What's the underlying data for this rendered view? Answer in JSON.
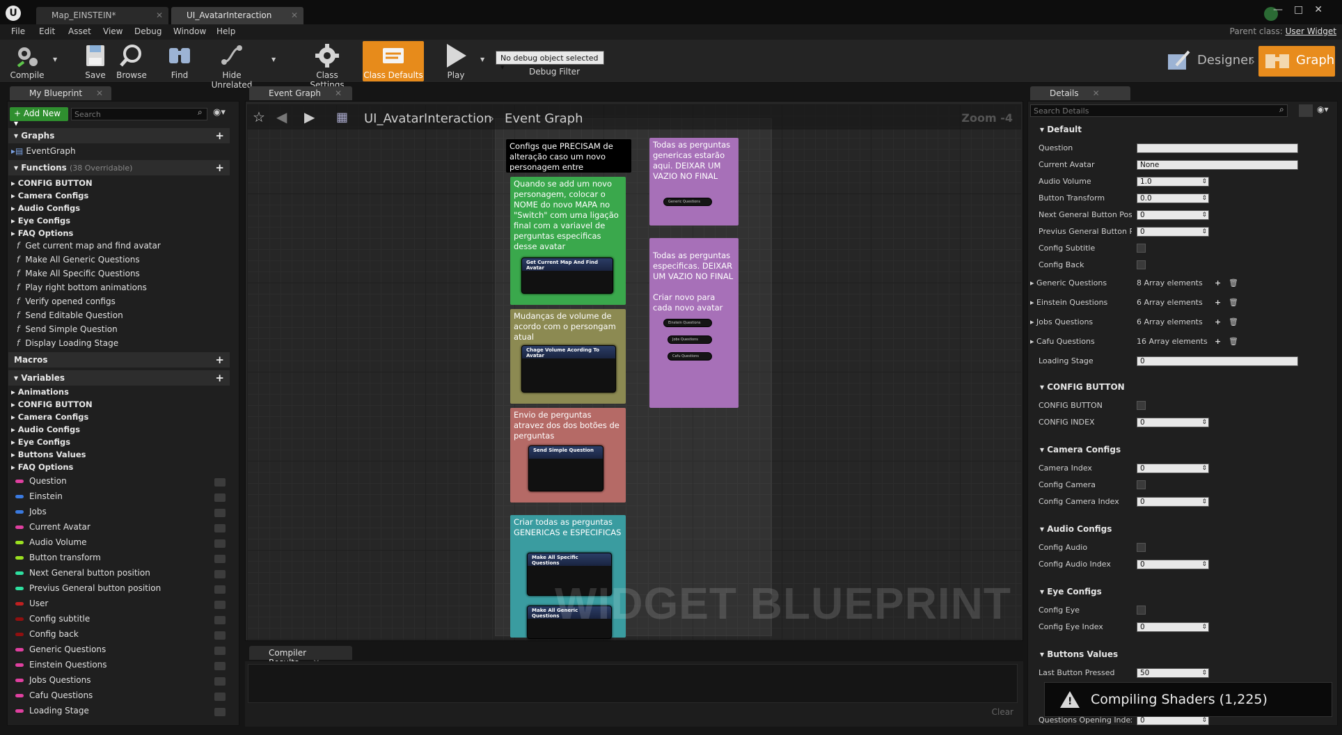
{
  "window": {
    "tabs": [
      {
        "label": "Map_EINSTEIN*"
      },
      {
        "label": "UI_AvatarInteraction"
      }
    ],
    "controls": [
      "—",
      "□",
      "✕"
    ]
  },
  "menu": {
    "items": [
      "File",
      "Edit",
      "Asset",
      "View",
      "Debug",
      "Window",
      "Help"
    ],
    "parent_class_label": "Parent class:",
    "parent_class_value": "User Widget"
  },
  "toolbar": {
    "compile": "Compile",
    "save": "Save",
    "browse": "Browse",
    "find": "Find",
    "hide_unrelated": "Hide Unrelated",
    "class_settings": "Class Settings",
    "class_defaults": "Class Defaults",
    "play": "Play",
    "debug_select": "No debug object selected ▾",
    "debug_filter": "Debug Filter",
    "designer": "Designer",
    "graph": "Graph"
  },
  "my_blueprint": {
    "tab_label": "My Blueprint",
    "add_new": "+ Add New ▾",
    "search_placeholder": "Search",
    "graphs_header": "Graphs",
    "graphs": [
      "EventGraph"
    ],
    "functions_header": "Functions",
    "functions_overridable": "(38 Overridable)",
    "function_categories": [
      "CONFIG BUTTON",
      "Camera Configs",
      "Audio Configs",
      "Eye Configs",
      "FAQ Options"
    ],
    "functions": [
      "Get current map and find avatar",
      "Make All Generic Questions",
      "Make All Specific Questions",
      "Play right bottom animations",
      "Verify opened configs",
      "Send Editable Question",
      "Send Simple Question",
      "Display Loading Stage"
    ],
    "macros_header": "Macros",
    "variables_header": "Variables",
    "variable_categories": [
      "Animations",
      "CONFIG BUTTON",
      "Camera Configs",
      "Audio Configs",
      "Eye Configs",
      "Buttons Values",
      "FAQ Options"
    ],
    "variables": [
      {
        "name": "Question",
        "color": "#e040a0"
      },
      {
        "name": "Einstein",
        "color": "#3a7ae0"
      },
      {
        "name": "Jobs",
        "color": "#3a7ae0"
      },
      {
        "name": "Current Avatar",
        "color": "#e040a0"
      },
      {
        "name": "Audio Volume",
        "color": "#9be020"
      },
      {
        "name": "Button transform",
        "color": "#9be020"
      },
      {
        "name": "Next General button position",
        "color": "#2ee0a0"
      },
      {
        "name": "Previus General button position",
        "color": "#2ee0a0"
      },
      {
        "name": "User",
        "color": "#c02020"
      },
      {
        "name": "Config subtitle",
        "color": "#901010"
      },
      {
        "name": "Config back",
        "color": "#901010"
      },
      {
        "name": "Generic Questions",
        "color": "#e040a0"
      },
      {
        "name": "Einstein Questions",
        "color": "#e040a0"
      },
      {
        "name": "Jobs Questions",
        "color": "#e040a0"
      },
      {
        "name": "Cafu Questions",
        "color": "#e040a0"
      },
      {
        "name": "Loading Stage",
        "color": "#e040a0"
      }
    ]
  },
  "event_graph": {
    "tab_label": "Event Graph",
    "breadcrumb_root": "UI_AvatarInteraction",
    "breadcrumb_current": "Event Graph",
    "zoom": "Zoom -4",
    "watermark": "WIDGET BLUEPRINT",
    "comments": {
      "header": "Configs que PRECISAM de alteração caso um novo personagem entre",
      "green": "Quando se add um novo personagem, colocar o NOME do novo MAPA no \"Switch\" com uma ligação final com a variavel de perguntas especificas desse avatar",
      "yellow": "Mudanças de volume de acordo com o persongam atual",
      "red": "Envio de perguntas atravez dos dos botões de perguntas",
      "teal": "Criar todas as perguntas GENERICAS e ESPECIFICAS",
      "purple1": "Todas as perguntas genericas estarão aqui. DEIXAR UM VAZIO NO FINAL",
      "purple2": "Todas as perguntas especificas. DEIXAR UM VAZIO NO FINAL\n\nCriar novo para cada novo avatar"
    },
    "nodes": {
      "get_map": "Get Current Map And Find Avatar",
      "volume": "Chage Volume Acording To Avatar",
      "send_simple": "Send Simple Question",
      "make_specific": "Make All Specific Questions",
      "make_generic": "Make All Generic Questions",
      "generic_q": "Generic Questions",
      "einstein_q": "Einstein Questions",
      "jobs_q": "Jobs Questions",
      "cafu_q": "Cafu Questions"
    }
  },
  "compiler": {
    "tab_label": "Compiler Results",
    "clear": "Clear"
  },
  "details": {
    "tab_label": "Details",
    "search_placeholder": "Search Details",
    "sections": {
      "default": "Default",
      "config_button": "CONFIG BUTTON",
      "camera": "Camera Configs",
      "audio": "Audio Configs",
      "eye": "Eye Configs",
      "buttons": "Buttons Values"
    },
    "props": {
      "question": "Question",
      "current_avatar": "Current Avatar",
      "current_avatar_val": "None",
      "audio_volume": "Audio Volume",
      "audio_volume_val": "1.0",
      "button_transform": "Button Transform",
      "button_transform_val": "0.0",
      "next_general": "Next General Button Positi",
      "next_general_val": "0",
      "previus_general": "Previus General Button Pos",
      "previus_general_val": "0",
      "config_subtitle": "Config Subtitle",
      "config_back": "Config Back",
      "generic_q": "Generic Questions",
      "generic_q_val": "8 Array elements",
      "einstein_q": "Einstein Questions",
      "einstein_q_val": "6 Array elements",
      "jobs_q": "Jobs Questions",
      "jobs_q_val": "6 Array elements",
      "cafu_q": "Cafu Questions",
      "cafu_q_val": "16 Array elements",
      "loading_stage": "Loading Stage",
      "loading_stage_val": "0",
      "config_button": "CONFIG BUTTON",
      "config_index": "CONFIG INDEX",
      "config_index_val": "0",
      "camera_index": "Camera Index",
      "camera_index_val": "0",
      "config_camera": "Config Camera",
      "config_camera_index": "Config Camera Index",
      "config_camera_index_val": "0",
      "config_audio": "Config Audio",
      "config_audio_index": "Config Audio Index",
      "config_audio_index_val": "0",
      "config_eye": "Config Eye",
      "config_eye_index": "Config Eye Index",
      "config_eye_index_val": "0",
      "last_button": "Last Button Pressed",
      "last_button_val": "50",
      "questions_opening": "Questions Opening Index",
      "questions_opening_val": "0"
    }
  },
  "toast": {
    "text": "Compiling Shaders (1,225)"
  }
}
